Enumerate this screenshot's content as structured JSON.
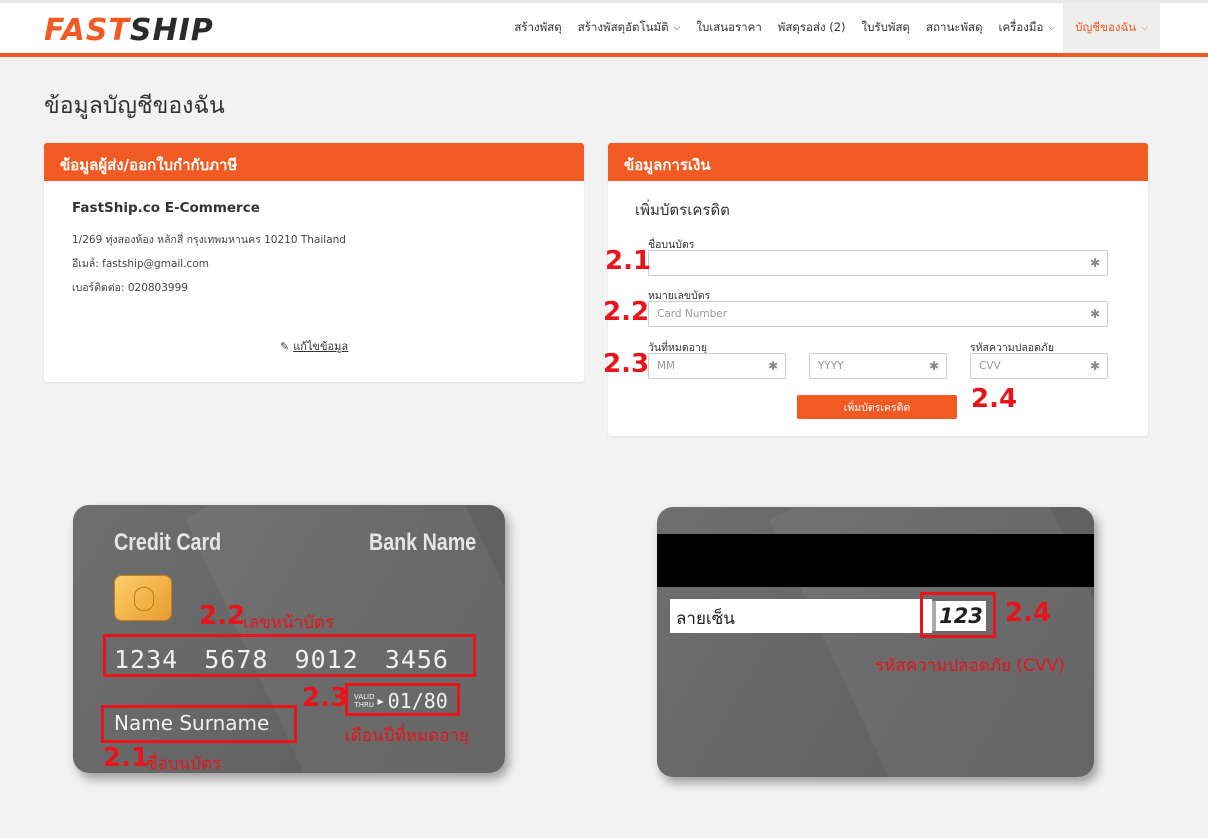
{
  "header": {
    "logo_fast": "FAST",
    "logo_ship": "SHIP",
    "nav": [
      {
        "label": "สร้างพัสดุ",
        "dropdown": false
      },
      {
        "label": "สร้างพัสดุอัตโนมัติ",
        "dropdown": true
      },
      {
        "label": "ใบเสนอราคา",
        "dropdown": false
      },
      {
        "label": "พัสดุรอส่ง (2)",
        "dropdown": false
      },
      {
        "label": "ใบรับพัสดุ",
        "dropdown": false
      },
      {
        "label": "สถานะพัสดุ",
        "dropdown": false
      },
      {
        "label": "เครื่องมือ",
        "dropdown": true
      },
      {
        "label": "บัญชีของฉัน",
        "dropdown": true,
        "active": true
      }
    ]
  },
  "page_title": "ข้อมูลบัญชีของฉัน",
  "sender": {
    "heading": "ข้อมูลผู้ส่ง/ออกใบกำกับภาษี",
    "company": "FastShip.co E-Commerce",
    "address": "1/269 ทุ่งสองห้อง หลักสี่ กรุงเทพมหานคร 10210 Thailand",
    "email": "อีเมล์: fastship@gmail.com",
    "phone": "เบอร์ติดต่อ: 020803999",
    "edit_label": "แก้ไขข้อมูล"
  },
  "payment": {
    "heading": "ข้อมูลการเงิน",
    "subheading": "เพิ่มบัตรเครดิต",
    "name_label": "ชื่อบนบัตร",
    "name_value": "",
    "number_label": "หมายเลขบัตร",
    "number_placeholder": "Card Number",
    "expiry_label": "วันที่หมดอายุ",
    "month_placeholder": "MM",
    "year_placeholder": "YYYY",
    "cvv_label": "รหัสความปลอดภัย",
    "cvv_placeholder": "CVV",
    "required_mark": "✱",
    "submit_label": "เพิ่มบัตรเครดิต"
  },
  "markers": {
    "m21": "2.1",
    "m22": "2.2",
    "m23": "2.3",
    "m24": "2.4"
  },
  "card_front": {
    "title": "Credit Card",
    "bank": "Bank Name",
    "number": "1234 5678 9012 3456",
    "valid_top": "VALID",
    "valid_bottom": "THRU",
    "expiry": "01/80",
    "holder": "Name Surname",
    "note_number": "เลขหน้าบัตร",
    "note_expiry": "เดือนปีที่หมดอายุ",
    "note_name": "ชื่อบนบัตร"
  },
  "card_back": {
    "signature": "ลายเซ็น",
    "cvv": "123",
    "note_cvv": "รหัสความปลอดภัย (CVV)"
  },
  "colors": {
    "brand": "#f15a22",
    "annotation": "#e8141c"
  }
}
